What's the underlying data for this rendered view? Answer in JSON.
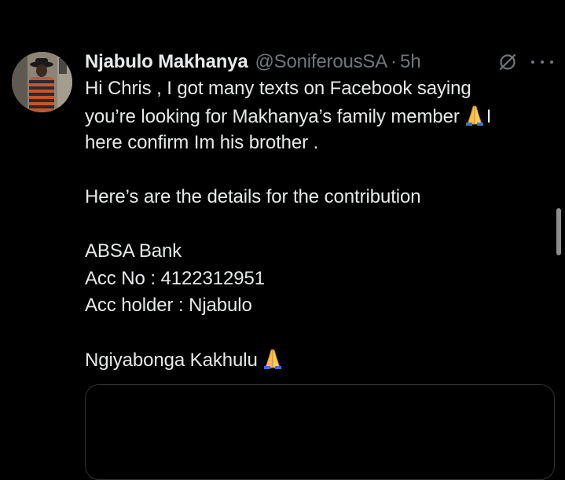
{
  "tweet": {
    "author_name": "Njabulo Makhanya",
    "author_handle": "@SoniferousSA",
    "separator": "·",
    "time": "5h",
    "lines": [
      "Hi Chris , I got many texts on Facebook saying",
      "you’re looking for Makhanya’s family member",
      "here confirm Im his brother .",
      "",
      "Here’s are the details for the contribution",
      "",
      "ABSA Bank",
      "Acc No : 4122312951",
      "Acc holder : Njabulo",
      "",
      "Ngiyabonga Kakhulu"
    ],
    "line2_suffix": "I"
  },
  "icons": {
    "avatar": "avatar",
    "grok": "grok-icon",
    "more": "more-icon",
    "emoji": "folded-hands-emoji"
  },
  "colors": {
    "background": "#000000",
    "text": "#e7e9ea",
    "secondary": "#71767b",
    "emoji": "#f5c04a"
  }
}
